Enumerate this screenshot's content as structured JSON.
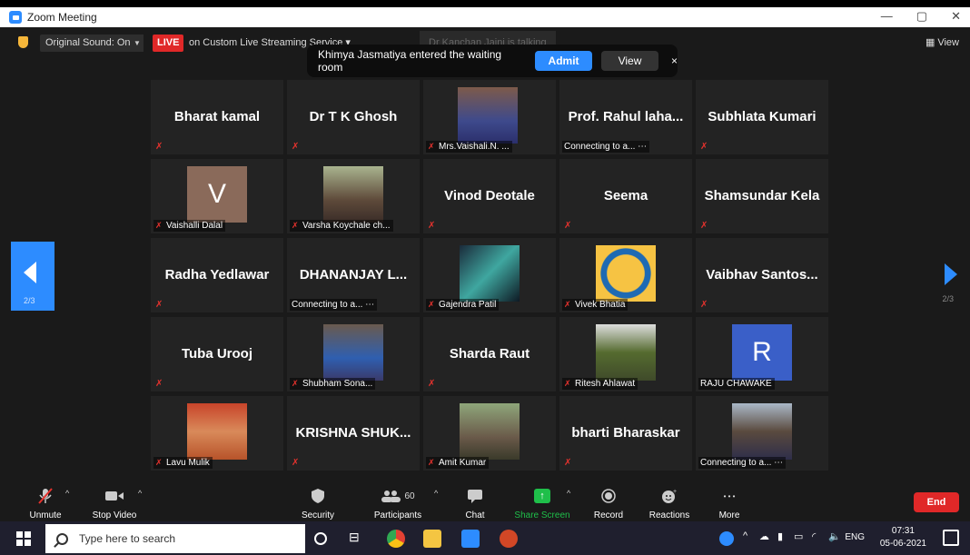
{
  "window": {
    "title": "Zoom Meeting",
    "minimize": "—",
    "restore": "▢",
    "close": "✕"
  },
  "topbar": {
    "original_sound": "Original Sound: On",
    "live": "LIVE",
    "stream": "on Custom Live Streaming Service",
    "talking": "Dr Kanchan Jaini is talking",
    "view": "View"
  },
  "notification": {
    "message": "Khimya Jasmatiya entered the waiting room",
    "admit": "Admit",
    "view": "View",
    "close": "×"
  },
  "pager": {
    "left_page": "2/3",
    "right_page": "2/3"
  },
  "tiles": [
    {
      "type": "name",
      "name": "Bharat kamal",
      "label": ""
    },
    {
      "type": "name",
      "name": "Dr T K Ghosh",
      "label": ""
    },
    {
      "type": "video",
      "name": "",
      "label": "Mrs.Vaishali.N. ..."
    },
    {
      "type": "name",
      "name": "Prof. Rahul laha...",
      "label": "Connecting to a... ⋯"
    },
    {
      "type": "name",
      "name": "Subhlata Kumari",
      "label": ""
    },
    {
      "type": "letter",
      "letter": "V",
      "name": "",
      "label": "Vaishalli Dalal"
    },
    {
      "type": "video",
      "name": "",
      "label": "Varsha Koychale ch..."
    },
    {
      "type": "name",
      "name": "Vinod Deotale",
      "label": ""
    },
    {
      "type": "name",
      "name": "Seema",
      "label": ""
    },
    {
      "type": "name",
      "name": "Shamsundar Kela",
      "label": ""
    },
    {
      "type": "name",
      "name": "Radha Yedlawar",
      "label": ""
    },
    {
      "type": "name",
      "name": "DHANANJAY  L...",
      "label": "Connecting to a... ⋯"
    },
    {
      "type": "video",
      "name": "",
      "label": "Gajendra Patil"
    },
    {
      "type": "video",
      "name": "",
      "label": "Vivek Bhatia"
    },
    {
      "type": "name",
      "name": "Vaibhav  Santos...",
      "label": ""
    },
    {
      "type": "name",
      "name": "Tuba Urooj",
      "label": ""
    },
    {
      "type": "video",
      "name": "",
      "label": "Shubham Sona..."
    },
    {
      "type": "name",
      "name": "Sharda Raut",
      "label": ""
    },
    {
      "type": "video",
      "name": "",
      "label": "Ritesh Ahlawat"
    },
    {
      "type": "letter",
      "letter": "R",
      "name": "",
      "label": "RAJU CHAWAKE"
    },
    {
      "type": "video",
      "name": "",
      "label": "Lavu Mulik"
    },
    {
      "type": "name",
      "name": "KRISHNA  SHUK...",
      "label": ""
    },
    {
      "type": "video",
      "name": "",
      "label": "Amit Kumar"
    },
    {
      "type": "name",
      "name": "bharti Bharaskar",
      "label": ""
    },
    {
      "type": "video",
      "name": "",
      "label": "Connecting to a... ⋯"
    }
  ],
  "toolbar": {
    "unmute": "Unmute",
    "stop_video": "Stop Video",
    "security": "Security",
    "participants": "Participants",
    "participants_count": "60",
    "chat": "Chat",
    "share_screen": "Share Screen",
    "record": "Record",
    "reactions": "Reactions",
    "more": "More",
    "more_dots": "• • •",
    "end": "End"
  },
  "taskbar": {
    "search_placeholder": "Type here to search",
    "language": "ENG",
    "time": "07:31",
    "date": "05-06-2021"
  },
  "colors": {
    "accent": "#2d8cff",
    "live": "#e02828",
    "share": "#1fbf4a",
    "muted": "#e5322d"
  }
}
